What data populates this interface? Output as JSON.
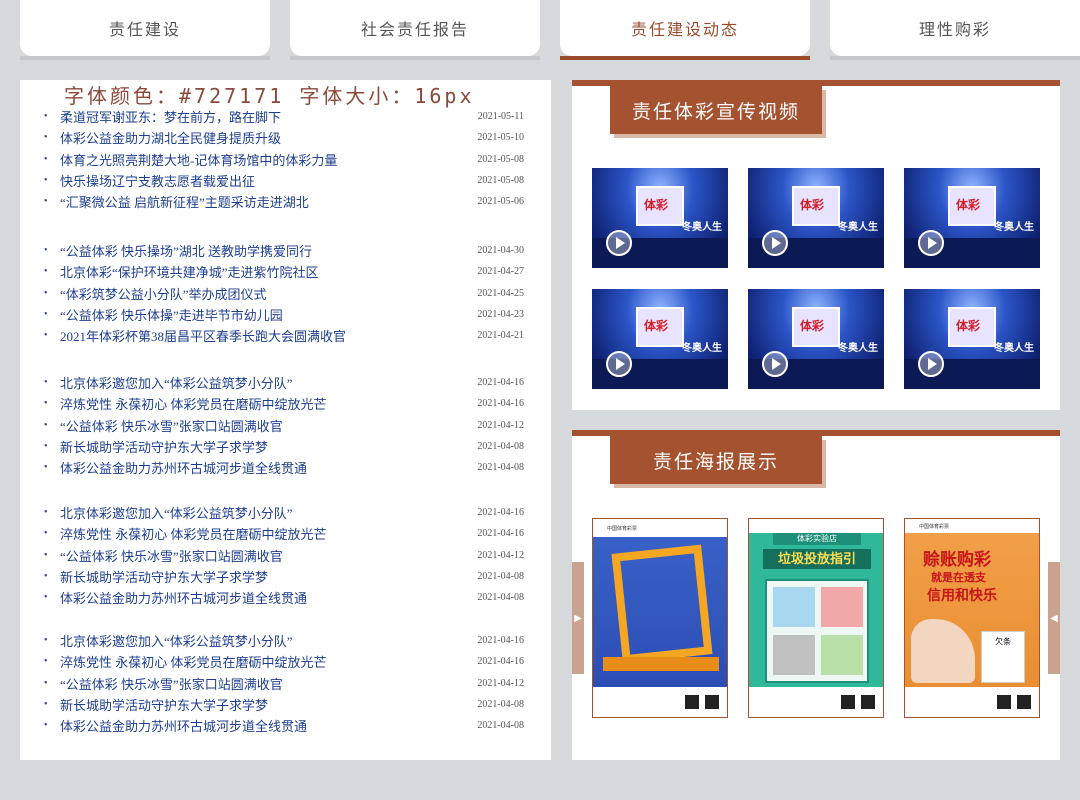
{
  "tabs": [
    {
      "label": "责任建设"
    },
    {
      "label": "社会责任报告"
    },
    {
      "label": "责任建设动态"
    },
    {
      "label": "理性购彩"
    }
  ],
  "note": "字体颜色：#727171 字体大小：16px",
  "news_groups": [
    [
      {
        "title": "柔道冠军谢亚东：梦在前方，路在脚下",
        "date": "2021-05-11"
      },
      {
        "title": "体彩公益金助力湖北全民健身提质升级",
        "date": "2021-05-10"
      },
      {
        "title": "体育之光照亮荆楚大地-记体育场馆中的体彩力量",
        "date": "2021-05-08"
      },
      {
        "title": "快乐操场辽宁支教志愿者载爱出征",
        "date": "2021-05-08"
      },
      {
        "title": "“汇聚微公益 启航新征程”主题采访走进湖北",
        "date": "2021-05-06"
      }
    ],
    [
      {
        "title": "“公益体彩 快乐操场”湖北 送教助学携爱同行",
        "date": "2021-04-30"
      },
      {
        "title": "北京体彩“保护环境共建净城”走进紫竹院社区",
        "date": "2021-04-27"
      },
      {
        "title": "“体彩筑梦公益小分队”举办成团仪式",
        "date": "2021-04-25"
      },
      {
        "title": "“公益体彩 快乐体操”走进毕节市幼儿园",
        "date": "2021-04-23"
      },
      {
        "title": "2021年体彩杯第38届昌平区春季长跑大会圆满收官",
        "date": "2021-04-21"
      }
    ],
    [
      {
        "title": "北京体彩邀您加入“体彩公益筑梦小分队”",
        "date": "2021-04-16"
      },
      {
        "title": "淬炼党性 永葆初心 体彩党员在磨砺中绽放光芒",
        "date": "2021-04-16"
      },
      {
        "title": "“公益体彩 快乐冰雪”张家口站圆满收官",
        "date": "2021-04-12"
      },
      {
        "title": "新长城助学活动守护东大学子求学梦",
        "date": "2021-04-08"
      },
      {
        "title": "体彩公益金助力苏州环古城河步道全线贯通",
        "date": "2021-04-08"
      }
    ],
    [
      {
        "title": "北京体彩邀您加入“体彩公益筑梦小分队”",
        "date": "2021-04-16"
      },
      {
        "title": "淬炼党性 永葆初心 体彩党员在磨砺中绽放光芒",
        "date": "2021-04-16"
      },
      {
        "title": "“公益体彩 快乐冰雪”张家口站圆满收官",
        "date": "2021-04-12"
      },
      {
        "title": "新长城助学活动守护东大学子求学梦",
        "date": "2021-04-08"
      },
      {
        "title": "体彩公益金助力苏州环古城河步道全线贯通",
        "date": "2021-04-08"
      }
    ],
    [
      {
        "title": "北京体彩邀您加入“体彩公益筑梦小分队”",
        "date": "2021-04-16"
      },
      {
        "title": "淬炼党性 永葆初心 体彩党员在磨砺中绽放光芒",
        "date": "2021-04-16"
      },
      {
        "title": "“公益体彩 快乐冰雪”张家口站圆满收官",
        "date": "2021-04-12"
      },
      {
        "title": "新长城助学活动守护东大学子求学梦",
        "date": "2021-04-08"
      },
      {
        "title": "体彩公益金助力苏州环古城河步道全线贯通",
        "date": "2021-04-08"
      }
    ]
  ],
  "video_panel": {
    "title": "责任体彩宣传视频",
    "thumb_logo": "体彩",
    "thumb_side": "冬奥人生",
    "count": 6
  },
  "poster_panel": {
    "title": "责任海报展示",
    "posters": [
      {
        "theme": "blue",
        "top": "中国体育彩票"
      },
      {
        "theme": "green",
        "top": "体彩实验店",
        "headline": "垃圾投放指引"
      },
      {
        "theme": "orange",
        "top": "中国体育彩票",
        "headline": "赊账购彩",
        "sub": "就是在透支",
        "tail": "信用和快乐",
        "note": "欠条"
      }
    ]
  },
  "colors": {
    "accent": "#a55231",
    "link": "#1e3f8f",
    "panel_bg": "#ffffff",
    "page_bg": "#d6dadd"
  },
  "icons": {
    "play": "play-icon",
    "arrow_left": "arrow-left-icon",
    "arrow_right": "arrow-right-icon",
    "bullet": "bullet-icon"
  }
}
